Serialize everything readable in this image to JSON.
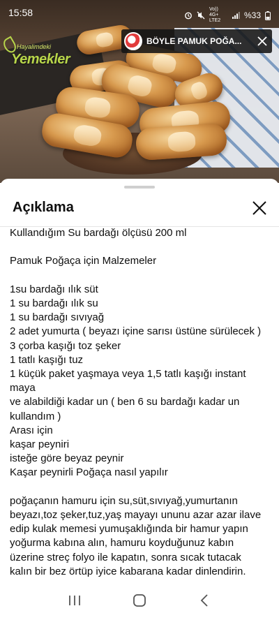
{
  "status_bar": {
    "time": "15:58",
    "network": "Vo)) 4G+ LTE2",
    "battery": "%33"
  },
  "video": {
    "logo_top": "Hayalimdeki",
    "logo_bottom": "Yemekler",
    "pip_title": "BÖYLE PAMUK POĞA..."
  },
  "sheet": {
    "title": "Açıklama",
    "lines": [
      "Kullandığım Su bardağı ölçüsü 200 ml",
      "",
      "Pamuk Poğaça için Malzemeler",
      "",
      "1su bardağı ılık süt",
      "1 su bardağı ılık su",
      "1 su bardağı sıvıyağ",
      "2 adet yumurta ( beyazı içine sarısı üstüne sürülecek )",
      "3 çorba kaşığı toz şeker",
      "1 tatlı kaşığı tuz",
      "1 küçük paket yaşmaya veya 1,5 tatlı kaşığı instant",
      "maya",
      "ve alabildiği kadar un ( ben 6 su bardağı kadar un",
      "kullandım )",
      "Arası için",
      "kaşar peyniri",
      "isteğe göre beyaz peynir",
      "Kaşar peynirli Poğaça nasıl yapılır",
      "",
      "poğaçanın hamuru için su,süt,sıvıyağ,yumurtanın",
      "beyazı,toz şeker,tuz,yaş mayayı ununu azar azar ilave",
      "edip kulak memesi yumuşaklığında bir hamur yapın",
      "yoğurma kabına alın, hamuru koyduğunuz kabın",
      "üzerine streç folyo ile kapatın, sonra sıcak tutacak",
      "kalın bir bez örtüp iyice kabarana kadar dinlendirin."
    ]
  },
  "icons": {
    "pip_close": "close-icon",
    "sheet_close": "close-icon",
    "nav_recents": "recents-icon",
    "nav_home": "home-icon",
    "nav_back": "back-icon"
  }
}
